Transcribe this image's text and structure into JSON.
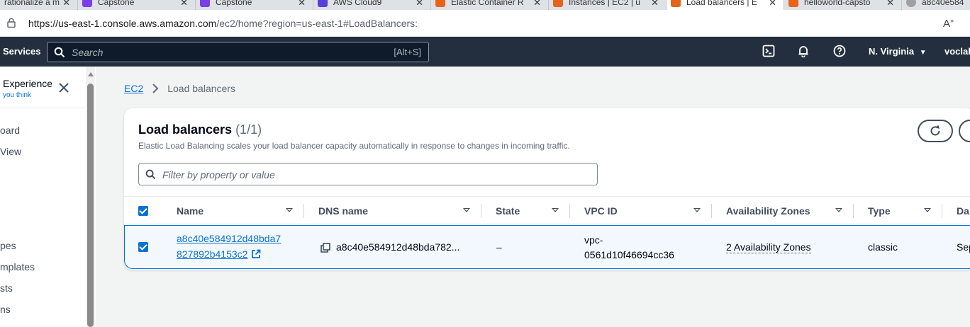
{
  "browser": {
    "tabs": [
      {
        "label": "rationalize a m",
        "color": "#a0a0a0"
      },
      {
        "label": "Capstone",
        "color": "#7b3fe4"
      },
      {
        "label": "Capstone",
        "color": "#7b3fe4"
      },
      {
        "label": "AWS Cloud9",
        "color": "#5a3fd8"
      },
      {
        "label": "Elastic Container R",
        "color": "#e8631a"
      },
      {
        "label": "Instances | EC2 | u",
        "color": "#e8631a"
      },
      {
        "label": "Load balancers | E",
        "color": "#e8631a"
      },
      {
        "label": "helloworld-capsto",
        "color": "#e8631a"
      },
      {
        "label": "a8c40e584",
        "color": "#a0a0a0"
      }
    ],
    "url_host": "https://us-east-1.console.aws.amazon.com",
    "url_path": "/ec2/home?region=us-east-1#LoadBalancers:"
  },
  "topnav": {
    "services": "Services",
    "search_placeholder": "Search",
    "search_shortcut": "[Alt+S]",
    "region": "N. Virginia",
    "account": "voclab"
  },
  "sidenav": {
    "experience_title": "Experience",
    "experience_sub": "you think",
    "items": [
      "oard",
      "View",
      "pes",
      "mplates",
      "sts",
      "ns"
    ]
  },
  "breadcrumb": {
    "root": "EC2",
    "current": "Load balancers"
  },
  "panel": {
    "title": "Load balancers",
    "count": "(1/1)",
    "description": "Elastic Load Balancing scales your load balancer capacity automatically in response to changes in incoming traffic.",
    "filter_placeholder": "Filter by property or value"
  },
  "table": {
    "columns": [
      "Name",
      "DNS name",
      "State",
      "VPC ID",
      "Availability Zones",
      "Type",
      "Da"
    ],
    "row": {
      "name_line1": "a8c40e584912d48bda7",
      "name_line2": "827892b4153c2",
      "dns": "a8c40e584912d48bda782...",
      "state": "–",
      "vpc_line1": "vpc-",
      "vpc_line2": "0561d10f46694cc36",
      "az": "2 Availability Zones",
      "type": "classic",
      "date": "Sep"
    }
  },
  "colors": {
    "aws_nav": "#232f3e",
    "link": "#0972d3",
    "selected_row": "#f2f8fd"
  }
}
